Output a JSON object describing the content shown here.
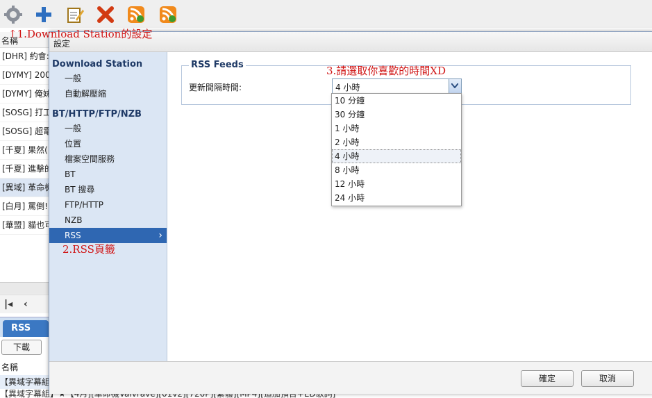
{
  "toolbar": {
    "icons": [
      "gear-icon",
      "add-icon",
      "edit-icon",
      "delete-icon",
      "rss-icon",
      "rss-refresh-icon"
    ]
  },
  "background": {
    "list_header": "名稱",
    "rows": [
      "[DHR] 約會:",
      "[DYMY] 200",
      "[DYMY] 俺妹",
      "[SOSG] 打工",
      "[SOSG] 超電",
      "[千夏] 果然(",
      "[千夏] 進擊的",
      "[異域] 革命機",
      "[白月] 罵倒!",
      "[華盟] 貓也可"
    ],
    "tab_label": "RSS Feed",
    "download_button": "下載",
    "list_header2": "名稱",
    "file1": "【異域字幕組",
    "file2": "【異域字幕組】★【4月][革命機Valvrave][01v2][720P][繁體][MP4][追加預告+ED歌詞]"
  },
  "dialog": {
    "title": "設定",
    "sidebar": {
      "sections": [
        {
          "heading": "Download Station",
          "items": [
            "一般",
            "自動解壓縮"
          ]
        },
        {
          "heading": "BT/HTTP/FTP/NZB",
          "items": [
            "一般",
            "位置",
            "檔案空間服務",
            "BT",
            "BT 搜尋",
            "FTP/HTTP",
            "NZB",
            "RSS"
          ]
        }
      ],
      "active_item": "RSS"
    },
    "content": {
      "legend": "RSS Feeds",
      "field_label": "更新間隔時間:",
      "selected_value": "4 小時",
      "options": [
        "10 分鐘",
        "30 分鐘",
        "1 小時",
        "2 小時",
        "4 小時",
        "8 小時",
        "12 小時",
        "24 小時"
      ]
    },
    "buttons": {
      "ok": "確定",
      "cancel": "取消"
    }
  },
  "annotations": {
    "a1": "↑1.Download Station的設定",
    "a2": "2.RSS頁籤",
    "a3": "3.請選取你喜歡的時間XD"
  },
  "colors": {
    "accent": "#2f67b2",
    "sidebar_bg": "#dbe6f4",
    "annotation": "#d01515"
  }
}
